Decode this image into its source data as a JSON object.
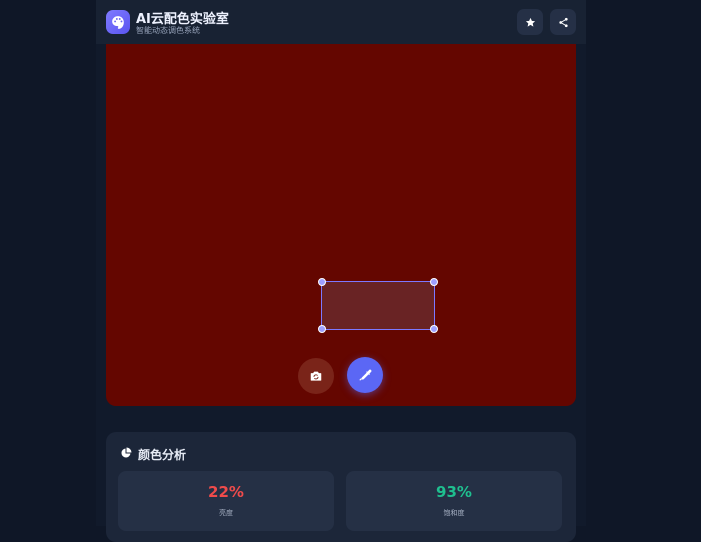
{
  "header": {
    "title": "AI云配色实验室",
    "subtitle": "智能动态调色系统",
    "favorite_icon": "star-icon",
    "share_icon": "share-icon",
    "logo_icon": "palette-icon"
  },
  "canvas": {
    "color": "#640600",
    "camera_icon": "camera-switch-icon",
    "picker_icon": "eyedropper-icon"
  },
  "analysis": {
    "title": "颜色分析",
    "icon": "pie-chart-icon",
    "brightness_value": "22%",
    "brightness_label": "亮度",
    "brightness_color": "#ef4b4b",
    "saturation_value": "93%",
    "saturation_label": "饱和度",
    "saturation_color": "#1fbf8f"
  }
}
